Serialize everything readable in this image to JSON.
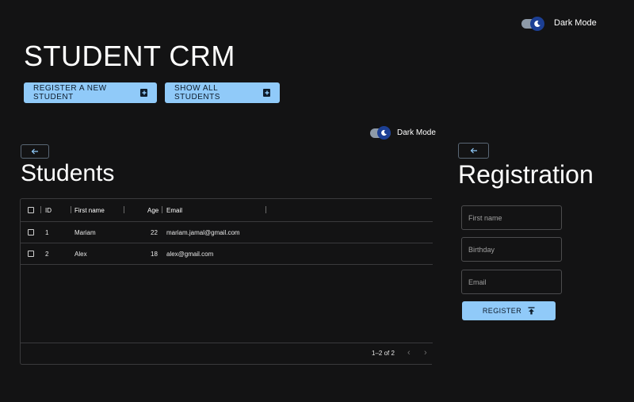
{
  "header": {
    "dark_mode_label": "Dark Mode",
    "app_title": "STUDENT CRM",
    "register_new_label": "REGISTER A NEW STUDENT",
    "show_all_label": "SHOW ALL STUDENTS"
  },
  "inner": {
    "dark_mode_label": "Dark Mode"
  },
  "students": {
    "title": "Students",
    "columns": [
      "ID",
      "First name",
      "Age",
      "Email"
    ],
    "rows": [
      {
        "id": "1",
        "first_name": "Mariam",
        "age": "22",
        "email": "mariam.jamal@gmail.com"
      },
      {
        "id": "2",
        "first_name": "Alex",
        "age": "18",
        "email": "alex@gmail.com"
      }
    ],
    "pagination": "1–2 of 2"
  },
  "registration": {
    "title": "Registration",
    "first_name_placeholder": "First name",
    "birthday_placeholder": "Birthday",
    "email_placeholder": "Email",
    "submit_label": "REGISTER"
  },
  "colors": {
    "background": "#131314",
    "accent": "#90caf9",
    "toggle_thumb": "#1c3f94"
  },
  "icons": {
    "toggle": "moon-icon",
    "back": "arrow-left-icon",
    "add": "plus-box-icon",
    "submit": "upload-icon",
    "prev_page": "chevron-left-icon",
    "next_page": "chevron-right-icon"
  }
}
